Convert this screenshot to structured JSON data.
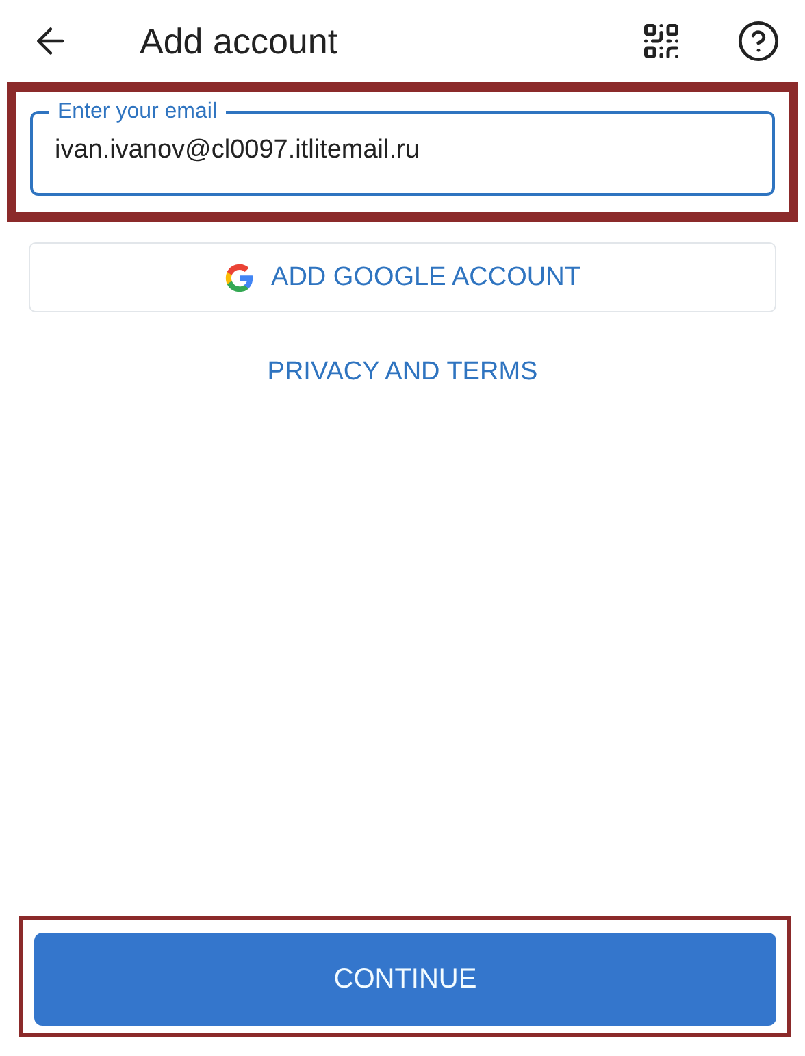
{
  "header": {
    "title": "Add account"
  },
  "email": {
    "placeholder": "Enter your email",
    "value": "ivan.ivanov@cl0097.itlitemail.ru",
    "highlighted": true
  },
  "google_button": {
    "label": "ADD GOOGLE ACCOUNT"
  },
  "privacy_link": {
    "label": "PRIVACY AND TERMS"
  },
  "continue_button": {
    "label": "CONTINUE",
    "highlighted": true
  }
}
